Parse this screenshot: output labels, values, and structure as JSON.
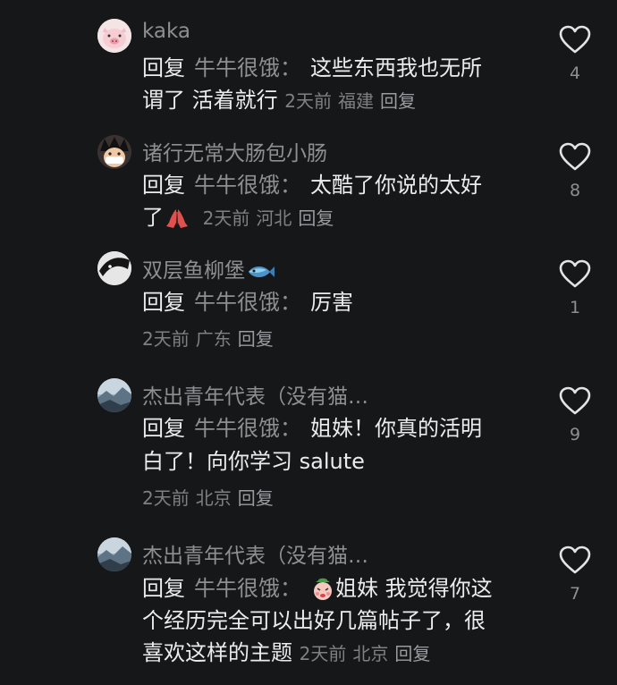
{
  "comments": [
    {
      "username": "kaka",
      "reply_prefix": "回复",
      "reply_target": "牛牛很饿",
      "colon": "：",
      "text_line1": "这些东西我也无所",
      "text_line2": "谓了 活着就行",
      "time": "2天前",
      "location": "福建",
      "reply_label": "回复",
      "likes": "4"
    },
    {
      "username": "诸行无常大肠包小肠",
      "reply_prefix": "回复",
      "reply_target": "牛牛很饿",
      "colon": "：",
      "text_line1": "太酷了你说的太好",
      "text_line2": "了",
      "time": "2天前",
      "location": "河北",
      "reply_label": "回复",
      "likes": "8"
    },
    {
      "username": "双层鱼柳堡",
      "reply_prefix": "回复",
      "reply_target": "牛牛很饿",
      "colon": "：",
      "text_line1": "厉害",
      "time": "2天前",
      "location": "广东",
      "reply_label": "回复",
      "likes": "1"
    },
    {
      "username": "杰出青年代表（没有猫…",
      "reply_prefix": "回复",
      "reply_target": "牛牛很饿",
      "colon": "：",
      "text_line1": "姐妹！你真的活明",
      "text_line2": "白了！向你学习 salute",
      "time": "2天前",
      "location": "北京",
      "reply_label": "回复",
      "likes": "9"
    },
    {
      "username": "杰出青年代表（没有猫…",
      "reply_prefix": "回复",
      "reply_target": "牛牛很饿",
      "colon": "：",
      "text_line1": "姐妹 我觉得你这",
      "text_line2": "个经历完全可以出好几篇帖子了，很",
      "text_line3": "喜欢这样的主题",
      "time": "2天前",
      "location": "北京",
      "reply_label": "回复",
      "likes": "7"
    }
  ],
  "colors": {
    "background": "#161719",
    "secondary_text": "#8e8f93",
    "primary_text": "#ececed"
  },
  "icons": {
    "like": "heart-outline-icon"
  }
}
